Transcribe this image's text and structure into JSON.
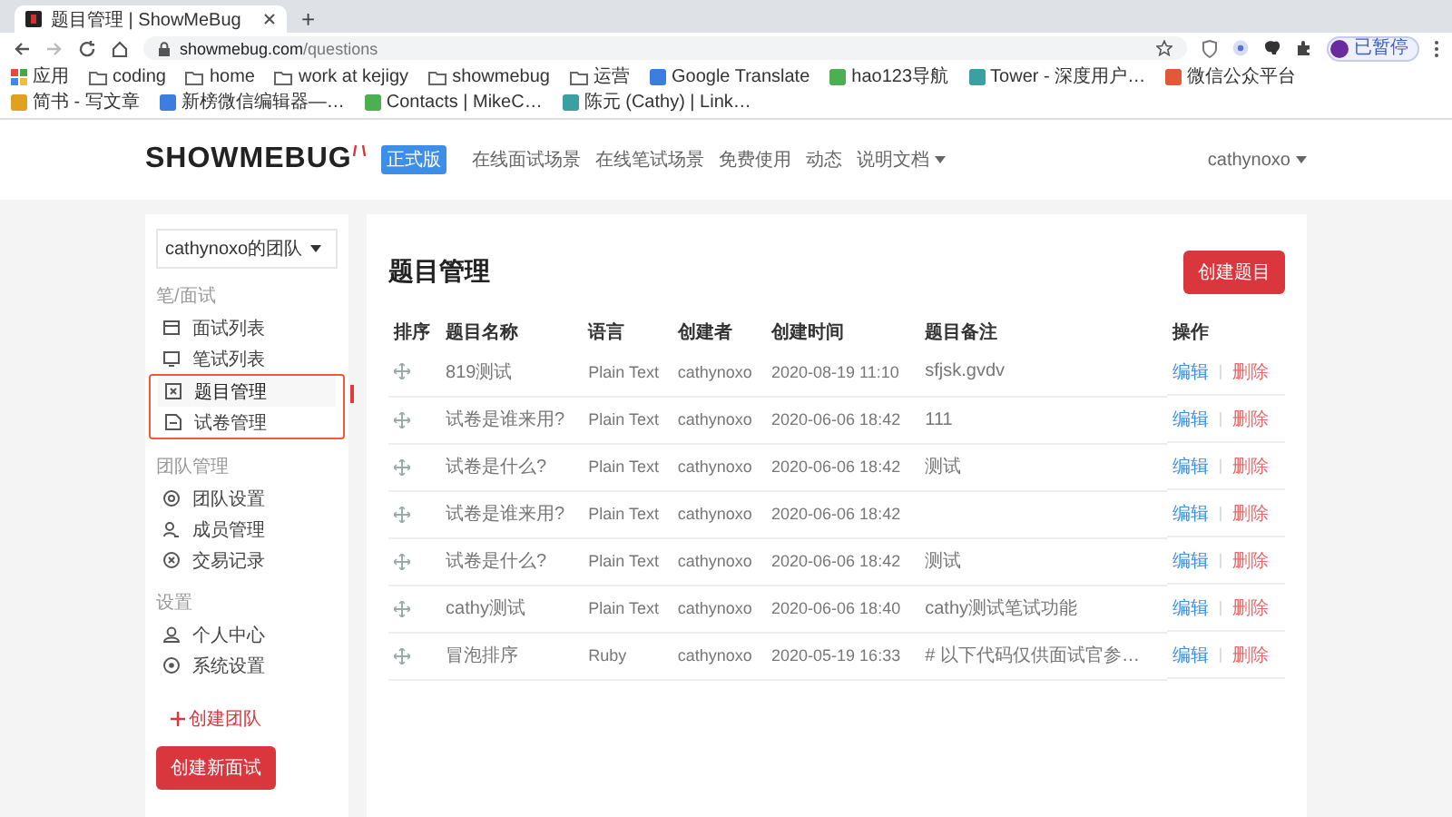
{
  "browser": {
    "tab_title": "题目管理 | ShowMeBug",
    "new_tab": "+",
    "url_host": "showmebug.com",
    "url_path": "/questions",
    "profile_label": "已暂停",
    "bookmarks": [
      {
        "label": "应用",
        "kind": "apps"
      },
      {
        "label": "coding",
        "kind": "folder"
      },
      {
        "label": "home",
        "kind": "folder"
      },
      {
        "label": "work at kejigy",
        "kind": "folder"
      },
      {
        "label": "showmebug",
        "kind": "folder"
      },
      {
        "label": "运营",
        "kind": "folder"
      },
      {
        "label": "Google Translate",
        "kind": "site"
      },
      {
        "label": "hao123导航",
        "kind": "site"
      },
      {
        "label": "Tower - 深度用户…",
        "kind": "site"
      },
      {
        "label": "微信公众平台",
        "kind": "site"
      },
      {
        "label": "简书 - 写文章",
        "kind": "site"
      },
      {
        "label": "新榜微信编辑器—…",
        "kind": "site"
      },
      {
        "label": "Contacts | MikeC…",
        "kind": "site"
      },
      {
        "label": "陈元 (Cathy) | Link…",
        "kind": "site"
      }
    ]
  },
  "header": {
    "logo": "SHOWMEBUG",
    "edition_badge": "正式版",
    "nav": [
      {
        "label": "在线面试场景",
        "dropdown": false
      },
      {
        "label": "在线笔试场景",
        "dropdown": false
      },
      {
        "label": "免费使用",
        "dropdown": false
      },
      {
        "label": "动态",
        "dropdown": false
      },
      {
        "label": "说明文档",
        "dropdown": true
      }
    ],
    "user": "cathynoxo"
  },
  "sidebar": {
    "team_select": "cathynoxo的团队",
    "groups": [
      {
        "title": "笔/面试",
        "items": [
          {
            "label": "面试列表",
            "selected": false,
            "highlighted": false
          },
          {
            "label": "笔试列表",
            "selected": false,
            "highlighted": false
          },
          {
            "label": "题目管理",
            "selected": true,
            "highlighted": true
          },
          {
            "label": "试卷管理",
            "selected": false,
            "highlighted": true
          }
        ]
      },
      {
        "title": "团队管理",
        "items": [
          {
            "label": "团队设置",
            "selected": false,
            "highlighted": false
          },
          {
            "label": "成员管理",
            "selected": false,
            "highlighted": false
          },
          {
            "label": "交易记录",
            "selected": false,
            "highlighted": false
          }
        ]
      },
      {
        "title": "设置",
        "items": [
          {
            "label": "个人中心",
            "selected": false,
            "highlighted": false
          },
          {
            "label": "系统设置",
            "selected": false,
            "highlighted": false
          }
        ]
      }
    ],
    "create_team": "创建团队",
    "create_interview": "创建新面试"
  },
  "main": {
    "title": "题目管理",
    "create_button": "创建题目",
    "table": {
      "columns": [
        "排序",
        "题目名称",
        "语言",
        "创建者",
        "创建时间",
        "题目备注",
        "操作"
      ],
      "rows": [
        {
          "name": "819测试",
          "language": "Plain Text",
          "creator": "cathynoxo",
          "created": "2020-08-19 11:10",
          "note": "sfjsk.gvdv",
          "edit": "编辑",
          "delete": "删除"
        },
        {
          "name": "试卷是谁来用?",
          "language": "Plain Text",
          "creator": "cathynoxo",
          "created": "2020-06-06 18:42",
          "note": "111",
          "edit": "编辑",
          "delete": "删除"
        },
        {
          "name": "试卷是什么?",
          "language": "Plain Text",
          "creator": "cathynoxo",
          "created": "2020-06-06 18:42",
          "note": "测试",
          "edit": "编辑",
          "delete": "删除"
        },
        {
          "name": "试卷是谁来用?",
          "language": "Plain Text",
          "creator": "cathynoxo",
          "created": "2020-06-06 18:42",
          "edit": "编辑",
          "delete": "删除"
        },
        {
          "name": "试卷是什么?",
          "language": "Plain Text",
          "creator": "cathynoxo",
          "created": "2020-06-06 18:42",
          "note": "测试",
          "edit": "编辑",
          "delete": "删除"
        },
        {
          "name": "cathy测试",
          "language": "Plain Text",
          "creator": "cathynoxo",
          "created": "2020-06-06 18:40",
          "note": "cathy测试笔试功能",
          "edit": "编辑",
          "delete": "删除"
        },
        {
          "name": "冒泡排序",
          "language": "Ruby",
          "creator": "cathynoxo",
          "created": "2020-05-19 16:33",
          "note": "# 以下代码仅供面试官参…",
          "edit": "编辑",
          "delete": "删除"
        }
      ]
    }
  }
}
